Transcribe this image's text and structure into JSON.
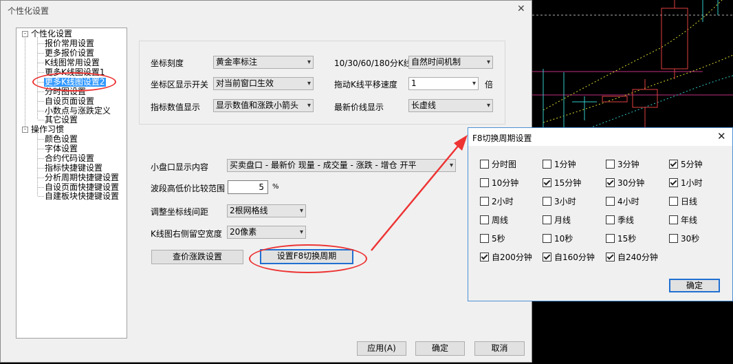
{
  "window": {
    "title": "个性化设置",
    "close_glyph": "✕"
  },
  "tree": {
    "group1": {
      "label": "个性化设置",
      "toggle": "-"
    },
    "group1_items": [
      "报价常用设置",
      "更多报价设置",
      "K线图常用设置",
      "更多K线图设置1",
      "更多K线图设置2",
      "分时图设置",
      "自设页面设置",
      "小数点与涨跌定义",
      "其它设置"
    ],
    "group2": {
      "label": "操作习惯",
      "toggle": "-"
    },
    "group2_items": [
      "颜色设置",
      "字体设置",
      "合约代码设置",
      "指标快捷键设置",
      "分析周期快捷键设置",
      "自设页面快捷键设置",
      "自建板块快捷键设置"
    ]
  },
  "settings": {
    "coord_scale": {
      "label": "坐标刻度",
      "value": "黄金率标注"
    },
    "coord_area": {
      "label": "坐标区显示开关",
      "value": "对当前窗口生效"
    },
    "indicator_value": {
      "label": "指标数值显示",
      "value": "显示数值和涨跌小箭头"
    },
    "kline_period": {
      "label": "10/30/60/180分K线",
      "value": "自然时间机制"
    },
    "drag_speed": {
      "label": "拖动K线平移速度",
      "value": "1",
      "unit": "倍"
    },
    "latest_price": {
      "label": "最新价线显示",
      "value": "长虚线"
    },
    "mini_panel": {
      "label": "小盘口显示内容",
      "value": "买卖盘口 - 最新价 现量 - 成交量 - 涨跌 - 增仓 开平"
    },
    "wave_range": {
      "label": "波段高低价比较范围",
      "value": "5",
      "unit": "%"
    },
    "grid_spacing": {
      "label": "调整坐标线间距",
      "value": "2根网格线"
    },
    "right_margin": {
      "label": "K线图右侧留空宽度",
      "value": "20像素"
    }
  },
  "buttons": {
    "check_change": "查价涨跌设置",
    "f8_setup": "设置F8切换周期",
    "apply": "应用(A)",
    "ok": "确定",
    "cancel": "取消"
  },
  "f8_dialog": {
    "title": "F8切换周期设置",
    "close_glyph": "✕",
    "ok": "确定",
    "options": [
      {
        "label": "分时图",
        "checked": false
      },
      {
        "label": "1分钟",
        "checked": false
      },
      {
        "label": "3分钟",
        "checked": false
      },
      {
        "label": "5分钟",
        "checked": true
      },
      {
        "label": "10分钟",
        "checked": false
      },
      {
        "label": "15分钟",
        "checked": true
      },
      {
        "label": "30分钟",
        "checked": true
      },
      {
        "label": "1小时",
        "checked": true
      },
      {
        "label": "2小时",
        "checked": false
      },
      {
        "label": "3小时",
        "checked": false
      },
      {
        "label": "4小时",
        "checked": false
      },
      {
        "label": "日线",
        "checked": false
      },
      {
        "label": "周线",
        "checked": false
      },
      {
        "label": "月线",
        "checked": false
      },
      {
        "label": "季线",
        "checked": false
      },
      {
        "label": "年线",
        "checked": false
      },
      {
        "label": "5秒",
        "checked": false
      },
      {
        "label": "10秒",
        "checked": false
      },
      {
        "label": "15秒",
        "checked": false
      },
      {
        "label": "30秒",
        "checked": false
      },
      {
        "label": "自200分钟",
        "checked": true
      },
      {
        "label": "自160分钟",
        "checked": true
      },
      {
        "label": "自240分钟",
        "checked": true
      }
    ]
  },
  "colors": {
    "annotation": "#ee3333",
    "selection": "#3399ff",
    "chart_bg": "#000000"
  }
}
